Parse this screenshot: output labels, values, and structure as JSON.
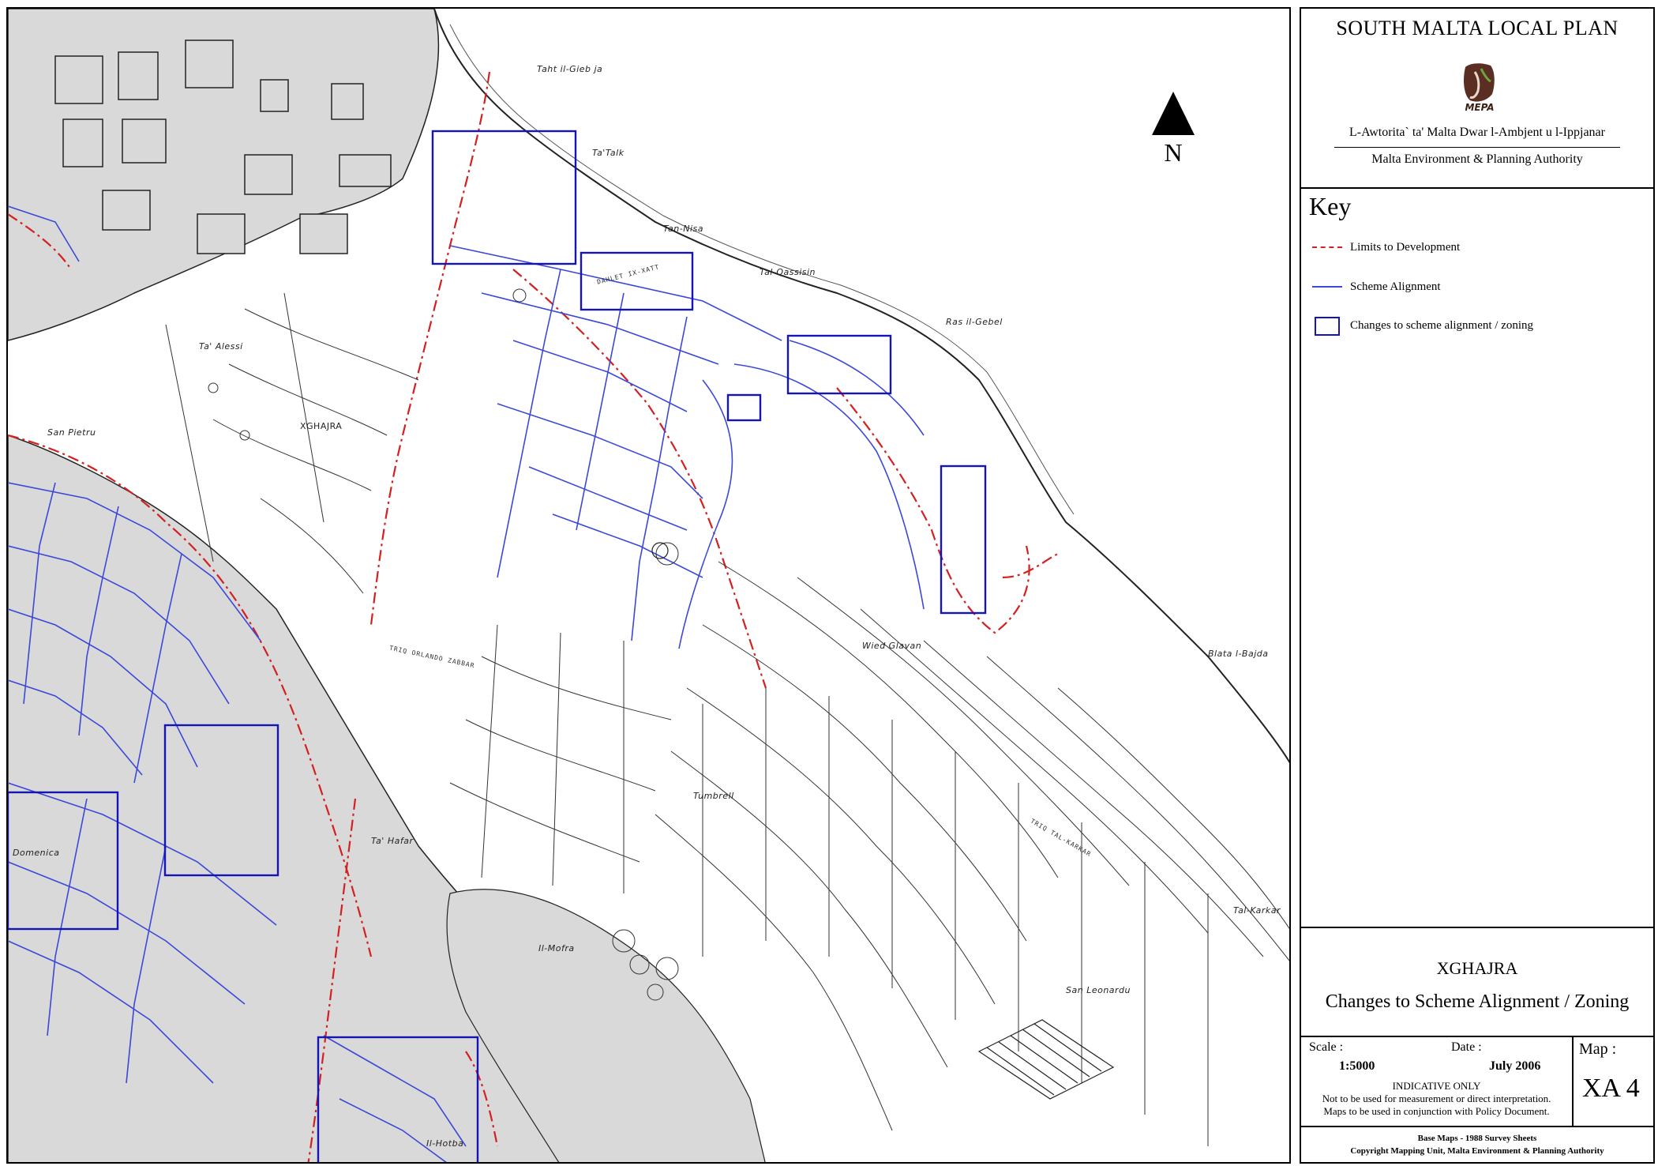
{
  "map": {
    "north_label": "N",
    "place_names": [
      {
        "name": "Taht il-Gieb ja",
        "id": "taht-il-giebja"
      },
      {
        "name": "Ta'Talk",
        "id": "ta-talk"
      },
      {
        "name": "Tan-Nisa",
        "id": "tan-nisa"
      },
      {
        "name": "Tal-Qassisin",
        "id": "tal-qassisin"
      },
      {
        "name": "Ras il-Gebel",
        "id": "ras-il-gebel"
      },
      {
        "name": "Ta' Alessi",
        "id": "ta-alessi"
      },
      {
        "name": "San Pietru",
        "id": "san-pietru"
      },
      {
        "name": "XGHAJRA",
        "id": "xghajra-village"
      },
      {
        "name": "Wied Glavan",
        "id": "wied-glavan"
      },
      {
        "name": "Blata l-Bajda",
        "id": "blata-l-bajda"
      },
      {
        "name": "Tumbrell",
        "id": "tumbrell"
      },
      {
        "name": "Domenica",
        "id": "domenica"
      },
      {
        "name": "Ta' Hafar",
        "id": "ta-hafar"
      },
      {
        "name": "Il-Mofra",
        "id": "il-mofra"
      },
      {
        "name": "Tal-Karkar",
        "id": "tal-karkar"
      },
      {
        "name": "San Leonardu",
        "id": "san-leonardu"
      },
      {
        "name": "Il-Hotba",
        "id": "il-hotba"
      }
    ],
    "street_names": [
      {
        "name": "TRIQ ORLANDO ZABBAR",
        "id": "triq-orlando-zabbar"
      },
      {
        "name": "DAHLET IX-XATT",
        "id": "dahlet-ix-xatt"
      },
      {
        "name": "TRIQ TAL-KARKAR",
        "id": "triq-tal-karkar"
      }
    ]
  },
  "legend": {
    "plan_title": "SOUTH MALTA LOCAL PLAN",
    "logo_text": "MEPA",
    "authority_maltese": "L-Awtorita` ta' Malta Dwar l-Ambjent u l-Ippjanar",
    "authority_english": "Malta Environment & Planning Authority",
    "key_title": "Key",
    "key_items": [
      {
        "label": "Limits to Development",
        "symbol": "red-dash-dot-line",
        "color": "#d32020"
      },
      {
        "label": "Scheme Alignment",
        "symbol": "blue-line",
        "color": "#3c48d8"
      },
      {
        "label": "Changes to scheme alignment / zoning",
        "symbol": "blue-box",
        "color": "#1515b5"
      }
    ],
    "sheet_place": "XGHAJRA",
    "sheet_subject": "Changes to Scheme Alignment / Zoning",
    "scale_label": "Scale :",
    "scale_value": "1:5000",
    "date_label": "Date :",
    "date_value": "July 2006",
    "map_label": "Map :",
    "map_number": "XA 4",
    "disclaimer": [
      "INDICATIVE ONLY",
      "Not to be used for measurement or direct interpretation.",
      "Maps to be used in conjunction with Policy Document."
    ],
    "base_maps": "Base Maps - 1988 Survey Sheets",
    "copyright": "Copyright Mapping Unit, Malta Environment & Planning Authority"
  },
  "colors": {
    "urban_fill": "#d9d9d9",
    "development_limit": "#d32020",
    "scheme_alignment": "#3c48d8",
    "change_box": "#1515b5",
    "sea": "#ffffff"
  }
}
